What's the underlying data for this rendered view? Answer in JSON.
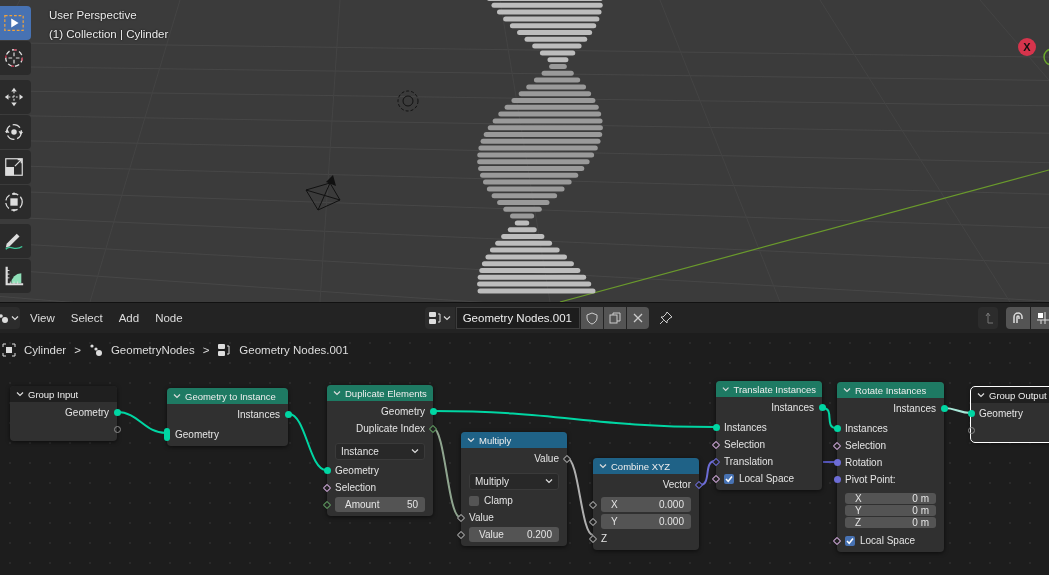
{
  "viewport": {
    "title": "User Perspective",
    "context": "(1) Collection | Cylinder",
    "tools": [
      {
        "kind": "select",
        "selected": true
      },
      {
        "kind": "cursor",
        "selected": false
      },
      {
        "kind": "move",
        "selected": false
      },
      {
        "kind": "rotate",
        "selected": false
      },
      {
        "kind": "scale",
        "selected": false
      },
      {
        "kind": "transform",
        "selected": false
      },
      {
        "kind": "annotate",
        "selected": false
      },
      {
        "kind": "measure",
        "selected": false
      }
    ],
    "gizmo": {
      "x_label": "X"
    }
  },
  "node_editor": {
    "menus": [
      "View",
      "Select",
      "Add",
      "Node"
    ],
    "node_tree": "Geometry Nodes.001",
    "breadcrumbs": [
      {
        "kind": "object",
        "label": "Cylinder"
      },
      {
        "kind": "modifier",
        "label": "GeometryNodes",
        "separator": ">"
      },
      {
        "kind": "node-tree",
        "label": "Geometry Nodes.001",
        "separator": ">"
      }
    ],
    "nodes": [
      {
        "title": "Group Input",
        "color": "#1f1f1f",
        "selected": false,
        "rows": [
          {
            "kind": "output",
            "label": "Geometry",
            "socket": {
              "kind": "geometry",
              "field": false
            }
          },
          {
            "kind": "output",
            "socket": {
              "kind": "virtual"
            }
          }
        ]
      },
      {
        "title": "Geometry to Instance",
        "color": "#1e7a63",
        "selected": false,
        "rows": [
          {
            "kind": "output",
            "label": "Instances",
            "socket": {
              "kind": "geometry",
              "field": false
            }
          },
          {
            "kind": "input",
            "label": "Geometry",
            "socket": {
              "kind": "geometry",
              "multi": true
            }
          }
        ]
      },
      {
        "title": "Duplicate Elements",
        "color": "#1e7a63",
        "selected": false,
        "rows": [
          {
            "kind": "output",
            "label": "Geometry",
            "socket": {
              "kind": "geometry",
              "field": false
            }
          },
          {
            "kind": "output",
            "label": "Duplicate Index",
            "socket": {
              "kind": "integer",
              "field": true
            }
          },
          {
            "kind": "dropdown",
            "value": "Instance"
          },
          {
            "kind": "input",
            "label": "Geometry",
            "socket": {
              "kind": "geometry",
              "field": false
            }
          },
          {
            "kind": "input",
            "label": "Selection",
            "socket": {
              "kind": "boolean",
              "field": true
            }
          },
          {
            "kind": "input-field",
            "label": "Amount",
            "value": "50",
            "socket": {
              "kind": "integer",
              "field": true
            }
          }
        ]
      },
      {
        "title": "Multiply",
        "color": "#1f6287",
        "selected": false,
        "rows": [
          {
            "kind": "output",
            "label": "Value",
            "socket": {
              "kind": "float",
              "field": true
            }
          },
          {
            "kind": "dropdown",
            "value": "Multiply"
          },
          {
            "kind": "checkbox",
            "label": "Clamp",
            "checked": false
          },
          {
            "kind": "input",
            "label": "Value",
            "socket": {
              "kind": "float",
              "field": true
            }
          },
          {
            "kind": "input-field",
            "label": "Value",
            "value": "0.200",
            "socket": {
              "kind": "float",
              "field": true
            }
          }
        ]
      },
      {
        "title": "Combine XYZ",
        "color": "#1f6287",
        "selected": false,
        "rows": [
          {
            "kind": "output",
            "label": "Vector",
            "socket": {
              "kind": "vector",
              "field": true
            }
          },
          {
            "kind": "input-field",
            "label": "X",
            "value": "0.000",
            "socket": {
              "kind": "float",
              "field": true
            }
          },
          {
            "kind": "input-field",
            "label": "Y",
            "value": "0.000",
            "socket": {
              "kind": "float",
              "field": true
            }
          },
          {
            "kind": "input",
            "label": "Z",
            "socket": {
              "kind": "float",
              "field": true
            }
          }
        ]
      },
      {
        "title": "Translate Instances",
        "color": "#1e7a63",
        "selected": false,
        "rows": [
          {
            "kind": "output",
            "label": "Instances",
            "socket": {
              "kind": "geometry",
              "field": false
            }
          },
          {
            "kind": "input",
            "label": "Instances",
            "socket": {
              "kind": "geometry",
              "field": false
            }
          },
          {
            "kind": "input",
            "label": "Selection",
            "socket": {
              "kind": "boolean",
              "field": true
            }
          },
          {
            "kind": "input",
            "label": "Translation",
            "socket": {
              "kind": "vector",
              "field": true
            }
          },
          {
            "kind": "checkbox",
            "label": "Local Space",
            "checked": true,
            "socket": {
              "kind": "boolean",
              "field": true
            }
          }
        ]
      },
      {
        "title": "Rotate Instances",
        "color": "#1e7a63",
        "selected": false,
        "rows": [
          {
            "kind": "output",
            "label": "Instances",
            "socket": {
              "kind": "geometry",
              "field": false
            }
          },
          {
            "kind": "input",
            "label": "Instances",
            "socket": {
              "kind": "geometry",
              "field": false
            }
          },
          {
            "kind": "input",
            "label": "Selection",
            "socket": {
              "kind": "boolean",
              "field": true
            }
          },
          {
            "kind": "input",
            "label": "Rotation",
            "socket": {
              "kind": "vector",
              "field": false
            }
          },
          {
            "kind": "input",
            "label": "Pivot Point:",
            "socket": {
              "kind": "vector",
              "field": false
            }
          },
          {
            "kind": "vector-fields",
            "items": [
              {
                "label": "X",
                "value": "0 m"
              },
              {
                "label": "Y",
                "value": "0 m"
              },
              {
                "label": "Z",
                "value": "0 m"
              }
            ]
          },
          {
            "kind": "checkbox",
            "label": "Local Space",
            "checked": true,
            "socket": {
              "kind": "boolean",
              "field": true
            }
          }
        ]
      },
      {
        "title": "Group Output",
        "color": "#1f1f1f",
        "selected": true,
        "rows": [
          {
            "kind": "input",
            "label": "Geometry",
            "socket": {
              "kind": "geometry",
              "field": false
            }
          },
          {
            "kind": "input",
            "socket": {
              "kind": "virtual"
            }
          }
        ]
      }
    ]
  }
}
